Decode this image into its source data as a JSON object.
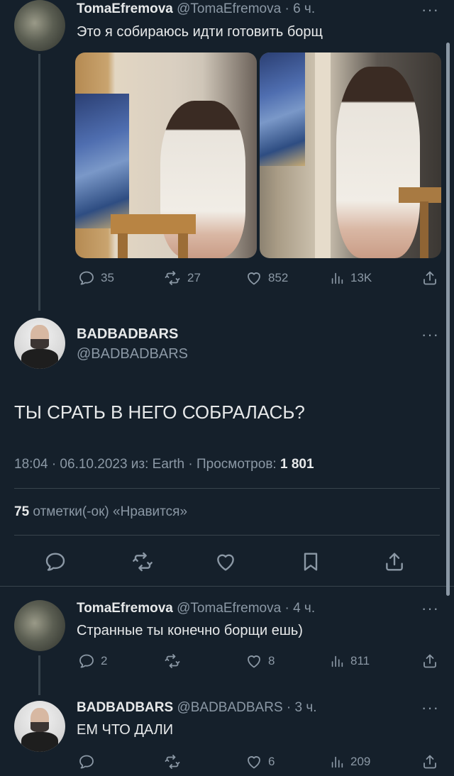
{
  "top_tweet": {
    "name": "TomaEfremova",
    "meta": "@TomaEfremova · 6 ч.",
    "text": "Это я собираюсь идти готовить борщ",
    "replies": "35",
    "retweets": "27",
    "likes": "852",
    "views": "13K"
  },
  "main_tweet": {
    "name": "BADBADBARS",
    "handle": "@BADBADBARS",
    "text": "ТЫ СРАТЬ В НЕГО СОБРАЛАСЬ?",
    "meta_prefix": "18:04 · 06.10.2023 из: Earth · Просмотров: ",
    "views_count": "1 801",
    "likes_count": "75",
    "likes_text": "отметки(-ок) «Нравится»"
  },
  "reply_1": {
    "name": "TomaEfremova",
    "meta": "@TomaEfremova · 4 ч.",
    "text": "Странные ты конечно борщи ешь)",
    "replies": "2",
    "retweets": "",
    "likes": "8",
    "views": "811"
  },
  "reply_2": {
    "name": "BADBADBARS",
    "meta": "@BADBADBARS · 3 ч.",
    "text": "ЕМ ЧТО ДАЛИ",
    "replies": "",
    "retweets": "",
    "likes": "6",
    "views": "209"
  },
  "icons": {
    "reply": "reply-icon",
    "retweet": "retweet-icon",
    "like": "heart-icon",
    "views": "views-icon",
    "share": "share-icon",
    "bookmark": "bookmark-icon",
    "more": "more-icon"
  },
  "colors": {
    "background": "#15202b",
    "text": "#e7e9ea",
    "muted": "#8b98a5",
    "divider": "#38444d"
  }
}
